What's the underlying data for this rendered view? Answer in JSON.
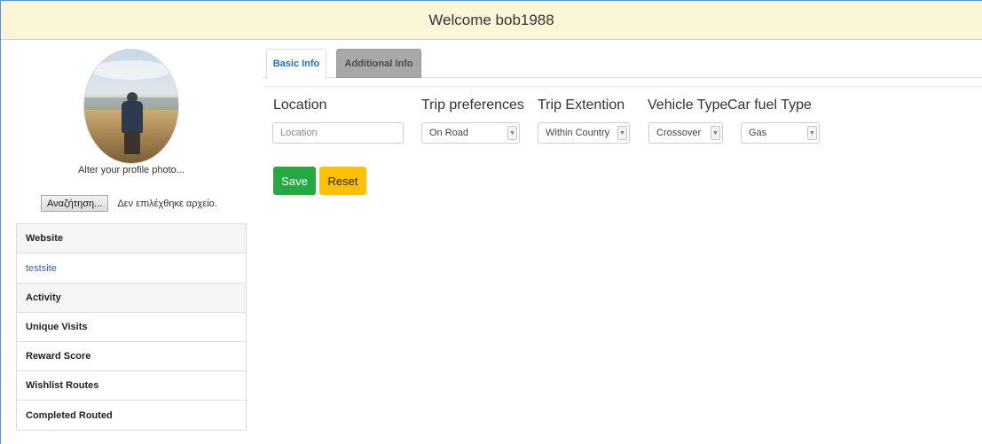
{
  "header": {
    "title": "Welcome bob1988"
  },
  "profile": {
    "alter_photo_text": "Alter your profile photo...",
    "file_button_label": "Αναζήτηση...",
    "file_status": "Δεν επιλέχθηκε αρχείο."
  },
  "sidebar": {
    "website_heading": "Website",
    "website_link": "testsite",
    "activity_heading": "Activity",
    "items": [
      "Unique Visits",
      "Reward Score",
      "Wishlist Routes",
      "Completed Routed"
    ]
  },
  "tabs": [
    {
      "label": "Basic Info",
      "active": true
    },
    {
      "label": "Additional Info",
      "active": false
    }
  ],
  "form": {
    "location": {
      "label": "Location",
      "placeholder": "Location",
      "value": ""
    },
    "trip_preferences": {
      "label": "Trip preferences",
      "selected": "On Road"
    },
    "trip_extention": {
      "label": "Trip Extention",
      "selected": "Within Country"
    },
    "vehicle_type": {
      "label": "Vehicle Type",
      "selected": "Crossover"
    },
    "car_fuel_type": {
      "label": "Car fuel Type",
      "selected": "Gas"
    }
  },
  "buttons": {
    "save": "Save",
    "reset": "Reset"
  },
  "colors": {
    "header_bg": "#fcf6d8",
    "save": "#28a745",
    "reset": "#ffc107",
    "active_tab_text": "#1a73c9",
    "inactive_tab_bg": "#a8a8a8"
  }
}
